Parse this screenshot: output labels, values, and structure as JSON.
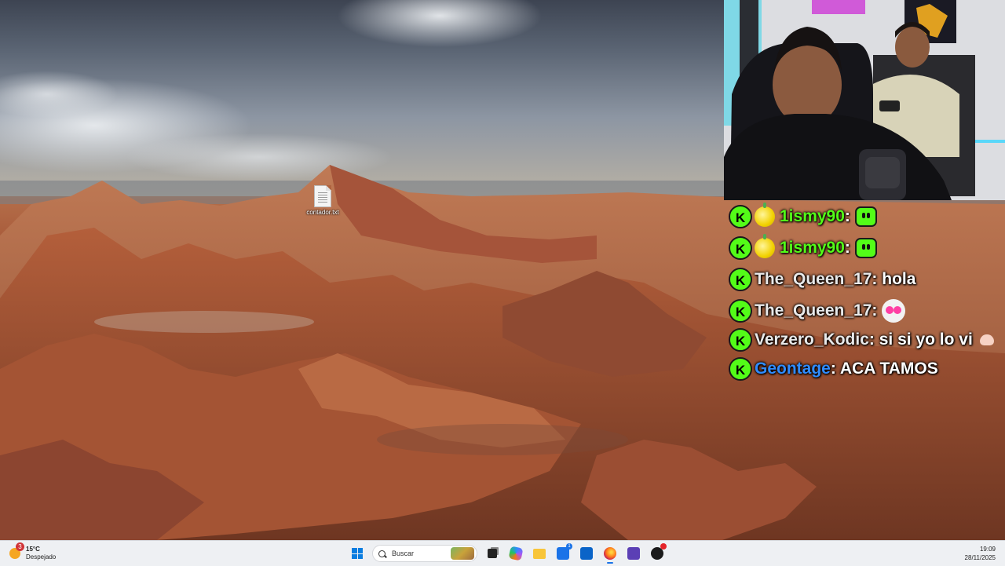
{
  "desktop": {
    "icons": [
      {
        "label": "contador.txt",
        "icon": "text-file-icon"
      }
    ]
  },
  "chat": {
    "messages": [
      {
        "username": "1ismy90",
        "text": "",
        "emote": "green-smile-emote",
        "badges": [
          "kick-badge",
          "subscriber-emote"
        ],
        "user_color": "#53fc18"
      },
      {
        "username": "1ismy90",
        "text": "",
        "emote": "green-smile-emote",
        "badges": [
          "kick-badge",
          "subscriber-emote"
        ],
        "user_color": "#53fc18"
      },
      {
        "username": "The_Queen_17",
        "text": "hola",
        "badges": [
          "kick-badge"
        ],
        "user_color": "#e9e9e9"
      },
      {
        "username": "The_Queen_17",
        "text": "",
        "emote": "heart-eyes-emote",
        "badges": [
          "kick-badge"
        ],
        "user_color": "#e9e9e9"
      },
      {
        "username": "Verzero_Kodic",
        "text": "si si yo lo vi",
        "emote": "flexed-arm-emote",
        "badges": [
          "kick-badge"
        ],
        "user_color": "#e9e9e9"
      },
      {
        "username": "Geontage",
        "text": "ACA TAMOS",
        "badges": [
          "kick-badge"
        ],
        "user_color": "#2f8cff"
      }
    ],
    "badge_letter": "K",
    "separator": ":"
  },
  "taskbar": {
    "weather": {
      "temp": "15°C",
      "condition": "Despejado",
      "alert_count": "3"
    },
    "search": {
      "placeholder": "Buscar"
    },
    "apps": [
      {
        "name": "task-view-icon"
      },
      {
        "name": "copilot-icon"
      },
      {
        "name": "file-explorer-icon"
      },
      {
        "name": "microsoft-store-icon",
        "badge": "1"
      },
      {
        "name": "outlook-icon"
      },
      {
        "name": "firefox-icon",
        "active": true
      },
      {
        "name": "chat-app-icon"
      },
      {
        "name": "obs-icon",
        "badge": ""
      }
    ],
    "clock": {
      "time": "19:09",
      "date": "28/11/2025"
    }
  },
  "colors": {
    "kick_green": "#53fc18",
    "taskbar_bg": "#eef0f3",
    "accent": "#0a7de0"
  }
}
